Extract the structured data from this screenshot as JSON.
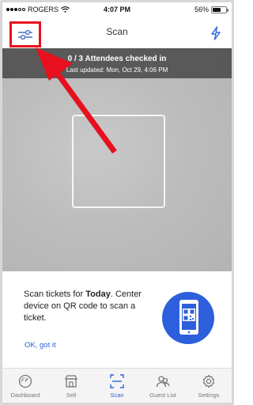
{
  "status_bar": {
    "carrier": "ROGERS",
    "time": "4:07 PM",
    "battery": "56%",
    "battery_level": 0.56
  },
  "nav": {
    "title": "Scan",
    "filter_icon": "sliders-icon",
    "bolt_icon": "lightning-icon"
  },
  "camera": {
    "checked_in": "0 / 3 Attendees checked in",
    "last_updated": "Last updated: Mon, Oct 29, 4:06 PM"
  },
  "info": {
    "text_before": "Scan tickets for ",
    "text_bold": "Today",
    "text_after": ". Center device on QR code to scan a ticket.",
    "ok_label": "OK, got it"
  },
  "tabs": [
    {
      "label": "Dashboard",
      "icon": "speedometer-icon",
      "active": false
    },
    {
      "label": "Sell",
      "icon": "storefront-icon",
      "active": false
    },
    {
      "label": "Scan",
      "icon": "scan-icon",
      "active": true
    },
    {
      "label": "Guest List",
      "icon": "guests-icon",
      "active": false
    },
    {
      "label": "Settings",
      "icon": "gear-icon",
      "active": false
    }
  ],
  "colors": {
    "accent": "#2b62d8",
    "annotation": "#e8101f",
    "banner": "#505050"
  }
}
